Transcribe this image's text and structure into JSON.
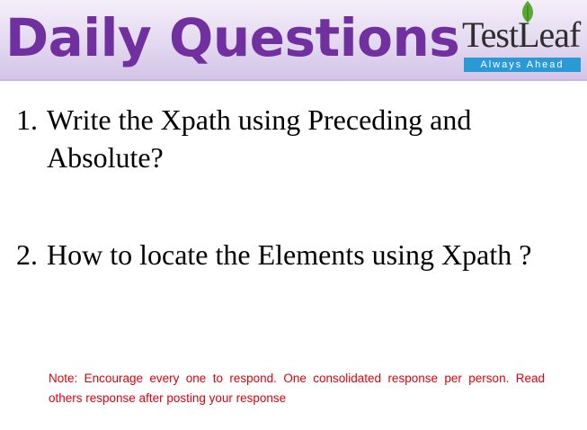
{
  "header": {
    "title": "Daily Questions",
    "logo": {
      "wordmark": "TestLeaf",
      "tagline": "Always Ahead"
    }
  },
  "questions": [
    {
      "number": "1.",
      "text": "Write the Xpath using Preceding and Absolute?"
    },
    {
      "number": "2.",
      "text": "How to locate the Elements using Xpath ?"
    }
  ],
  "note": "Note: Encourage every one to respond. One consolidated response per person. Read others response after posting your response",
  "colors": {
    "title": "#7030a0",
    "header_bg": "#e3d9f0",
    "note": "#e0000c",
    "logo_tag_bg": "#2a9ad7",
    "logo_leaf": "#5aa832"
  }
}
